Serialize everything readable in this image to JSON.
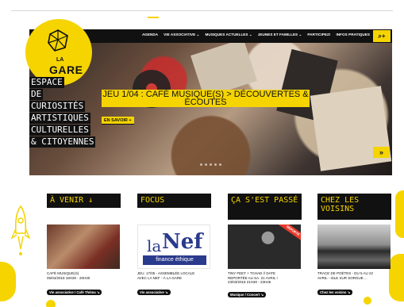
{
  "nav": {
    "items": [
      "AGENDA",
      "VIE ASSOCIATIVE ⌄",
      "MUSIQUES ACTUELLES ⌄",
      "JEUNES ET FAMILLES ⌄",
      "PARTICIPEZ!",
      "INFOS PRATIQUES"
    ],
    "search_glyph": "⌕+"
  },
  "logo": {
    "la": "LA",
    "gare": "GARE"
  },
  "tagline": [
    "ESPACE",
    "DE",
    "CURIOSITÉS",
    "ARTISTIQUES",
    "CULTURELLES",
    "& CITOYENNES"
  ],
  "hero": {
    "headline": "JEU 1/04 : CAFÉ MUSIQUE(S) > DÉCOUVERTES & ÉCOUTES",
    "more_label": "EN SAVOIR +",
    "next_glyph": "»"
  },
  "columns": [
    {
      "title": "À VENIR ↓",
      "text_line1": "CAFÉ MUSIQUE(S)",
      "text_line2": "05/04/2018 18H30 - 20H30",
      "tag": "Vie associative / Café Théma ↘"
    },
    {
      "title": "FOCUS",
      "nef_la": "la",
      "nef_nef": "Nef",
      "nef_sub": "finance éthique",
      "text_line1": "JEU. 17/05 - ASSEMBLÉE LOCALE",
      "text_line2": "AVEC LA NEF - À LA GARE",
      "tag": "Vie associative ↘"
    },
    {
      "title": "ÇA S'EST PASSÉ",
      "ribbon": "REPORTÉ",
      "text_line1": "TINY FEET + TCHAD // DATE",
      "text_line2": "REPORTÉE AU SA. 21 AVRIL !",
      "text_line3": "23/03/2018 21H30 - 23H45",
      "tag": "Musique / Concert ↘"
    },
    {
      "title": "CHEZ LES VOISINS",
      "text_line1": "TRACE DE POÈTES - DU 5 AU 22",
      "text_line2": "AVRIL - ISLE SUR SORGUE ...",
      "tag": "Chez les voisins ↘"
    }
  ]
}
